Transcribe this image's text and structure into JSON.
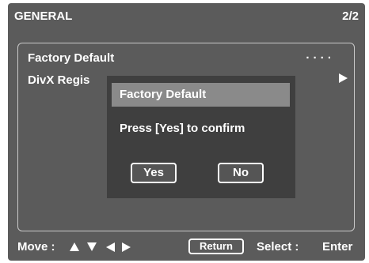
{
  "header": {
    "title": "GENERAL",
    "page": "2/2"
  },
  "menu": {
    "items": [
      {
        "label": "Factory Default",
        "value": "...."
      },
      {
        "label": "DivX Regis",
        "icon": "right-arrow-icon"
      }
    ]
  },
  "dialog": {
    "title": "Factory Default",
    "message": "Press [Yes] to confirm",
    "yes_label": "Yes",
    "no_label": "No"
  },
  "footer": {
    "move_label": "Move :",
    "nav_icons": [
      "up-arrow-icon",
      "down-arrow-icon",
      "left-arrow-icon",
      "right-arrow-icon"
    ],
    "return_label": "Return",
    "select_label": "Select :",
    "enter_label": "Enter"
  },
  "colors": {
    "screen_bg": "#5b5b5b",
    "dialog_bg": "#3f3f3f",
    "dialog_header_bg": "#8a8a8a",
    "text": "#ffffff"
  }
}
